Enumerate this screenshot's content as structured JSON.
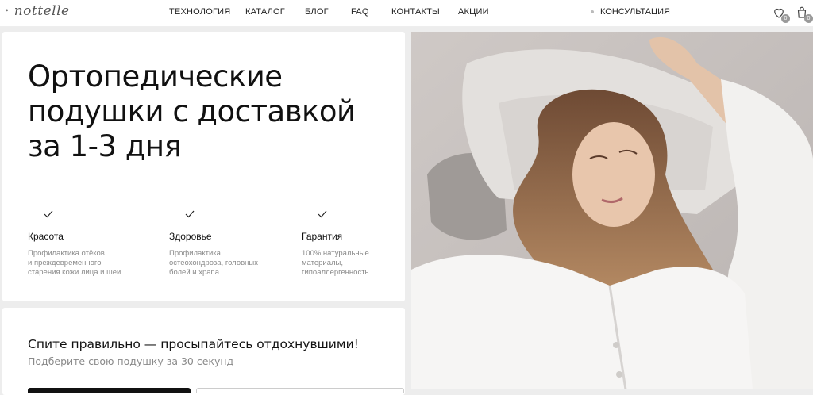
{
  "header": {
    "logo": "nottelle",
    "nav": [
      "ТЕХНОЛОГИЯ",
      "КАТАЛОГ",
      "БЛОГ",
      "FAQ",
      "КОНТАКТЫ",
      "АКЦИИ"
    ],
    "consultation": "КОНСУЛЬТАЦИЯ",
    "favorites_count": "0",
    "cart_count": "0"
  },
  "hero": {
    "title_lines": [
      "Ортопедические",
      "подушки с доставкой",
      "за 1-3 дня"
    ]
  },
  "features": [
    {
      "title": "Красота",
      "desc_lines": [
        "Профилактика отёков",
        "и преждевременного",
        "старения кожи лица и шеи"
      ]
    },
    {
      "title": "Здоровье",
      "desc_lines": [
        "Профилактика",
        "остеохондроза, головных",
        "болей и храпа"
      ]
    },
    {
      "title": "Гарантия",
      "desc_lines": [
        "100% натуральные",
        "материалы,",
        "гипоаллергенность"
      ]
    }
  ],
  "cta": {
    "title": "Спите правильно — просыпайтесь отдохнувшими!",
    "subtitle": "Подберите свою подушку за 30 секунд"
  },
  "colors": {
    "accent": "#111111",
    "muted": "#8a8a8a",
    "background": "#ededed"
  }
}
